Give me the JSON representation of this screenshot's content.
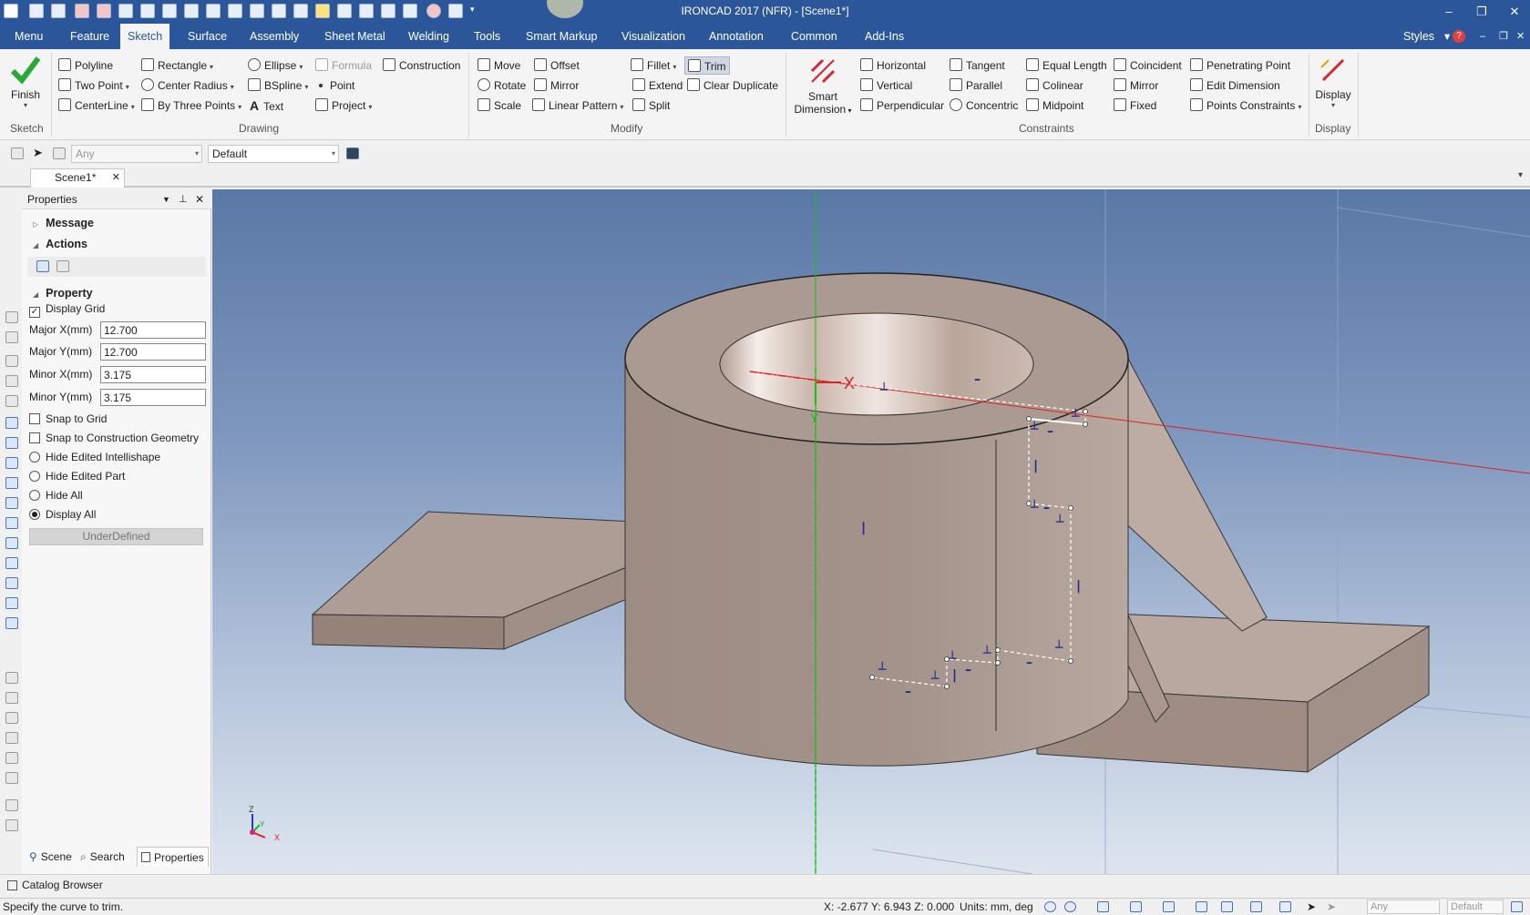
{
  "window": {
    "title": "IRONCAD 2017 (NFR) - [Scene1*]",
    "controls": {
      "minimize": "–",
      "restore": "❐",
      "close": "✕"
    }
  },
  "menu": {
    "tabs": [
      "Menu",
      "Feature",
      "Sketch",
      "Surface",
      "Assembly",
      "Sheet Metal",
      "Welding",
      "Tools",
      "Smart Markup",
      "Visualization",
      "Annotation",
      "Common",
      "Add-Ins"
    ],
    "active_tab": "Sketch",
    "styles_label": "Styles",
    "mdi_controls": {
      "minimize": "–",
      "restore": "❐",
      "close": "✕"
    }
  },
  "ribbon": {
    "sketch_group": {
      "finish_label": "Finish",
      "group_label": "Sketch"
    },
    "drawing_group": {
      "group_label": "Drawing",
      "polyline": "Polyline",
      "rectangle": "Rectangle",
      "ellipse": "Ellipse",
      "formula": "Formula",
      "construction": "Construction",
      "two_point": "Two Point",
      "center_radius": "Center Radius",
      "bspline": "BSpline",
      "point": "Point",
      "centerline": "CenterLine",
      "by_three_points": "By Three Points",
      "text": "Text",
      "project": "Project"
    },
    "modify_group": {
      "group_label": "Modify",
      "move": "Move",
      "offset": "Offset",
      "fillet": "Fillet",
      "trim": "Trim",
      "rotate": "Rotate",
      "mirror": "Mirror",
      "extend": "Extend",
      "clear_duplicate": "Clear Duplicate",
      "scale": "Scale",
      "linear_pattern": "Linear Pattern",
      "split": "Split"
    },
    "smart_dimension": {
      "line1": "Smart",
      "line2": "Dimension"
    },
    "constraints_group": {
      "group_label": "Constraints",
      "horizontal": "Horizontal",
      "tangent": "Tangent",
      "equal_length": "Equal Length",
      "coincident": "Coincident",
      "penetrating_point": "Penetrating Point",
      "vertical": "Vertical",
      "parallel": "Parallel",
      "colinear": "Colinear",
      "mirror": "Mirror",
      "edit_dimension": "Edit Dimension",
      "perpendicular": "Perpendicular",
      "concentric": "Concentric",
      "midpoint": "Midpoint",
      "fixed": "Fixed",
      "points_constraints": "Points Constraints"
    },
    "display_group": {
      "display_label": "Display",
      "group_label": "Display"
    }
  },
  "toolbar2": {
    "filter_value": "Any",
    "style_value": "Default"
  },
  "document": {
    "tab_label": "Scene1*",
    "close": "✕"
  },
  "properties_panel": {
    "title": "Properties",
    "sections": {
      "message": "Message",
      "actions": "Actions",
      "property": "Property"
    },
    "display_grid": {
      "label": "Display Grid",
      "checked": true
    },
    "fields": [
      {
        "label": "Major X(mm)",
        "value": "12.700"
      },
      {
        "label": "Major Y(mm)",
        "value": "12.700"
      },
      {
        "label": "Minor X(mm)",
        "value": "3.175"
      },
      {
        "label": "Minor Y(mm)",
        "value": "3.175"
      }
    ],
    "snap_to_grid": {
      "label": "Snap to Grid",
      "checked": false
    },
    "snap_to_construction": {
      "label": "Snap to Construction Geometry",
      "checked": false
    },
    "radios": [
      {
        "label": "Hide Edited Intellishape",
        "selected": false
      },
      {
        "label": "Hide Edited Part",
        "selected": false
      },
      {
        "label": "Hide All",
        "selected": false
      },
      {
        "label": "Display All",
        "selected": true
      }
    ],
    "state_button": "UnderDefined",
    "bottom_tabs": {
      "scene": "Scene",
      "search": "Search",
      "properties": "Properties"
    }
  },
  "viewport": {
    "sketch_axis_x": "X",
    "sketch_axis_y": "Y",
    "triad": {
      "z": "Z",
      "y": "Y",
      "x": "X"
    },
    "colors": {
      "part": "#a8968d",
      "sketch_constraint": "#1f2a8c",
      "x_axis": "#e02020",
      "y_axis": "#19c019"
    }
  },
  "catalog_browser": "Catalog Browser",
  "status": {
    "message": "Specify the curve to trim.",
    "coords": "X: -2.677 Y: 6.943 Z: 0.000",
    "units": "Units: mm, deg",
    "filter": "Any",
    "style": "Default"
  }
}
